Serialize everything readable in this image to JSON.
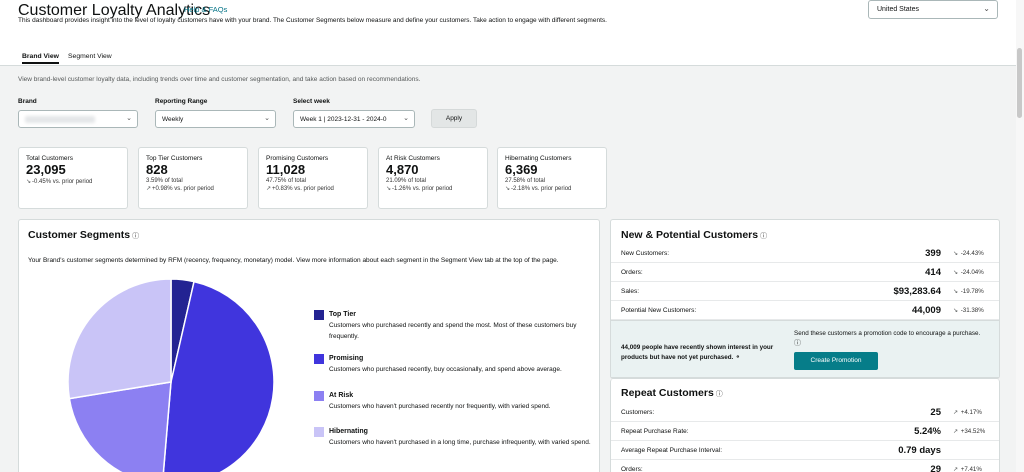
{
  "header": {
    "title": "Customer Loyalty Analytics",
    "help_link": "Help & FAQs",
    "description": "This dashboard provides insight into the level of loyalty customers have with your brand. The Customer Segments below measure and define your customers. Take action to engage with different segments.",
    "country": "United States"
  },
  "tabs": [
    {
      "label": "Brand View",
      "active": true
    },
    {
      "label": "Segment View",
      "active": false
    }
  ],
  "subdescription": "View brand-level customer loyalty data, including trends over time and customer segmentation, and take action based on recommendations.",
  "filters": {
    "brand_label": "Brand",
    "range_label": "Reporting Range",
    "range_value": "Weekly",
    "week_label": "Select week",
    "week_value": "Week 1 | 2023-12-31 - 2024-0",
    "apply": "Apply"
  },
  "cards": [
    {
      "label": "Total Customers",
      "value": "23,095",
      "sub": "",
      "trend": "-0.45% vs. prior period",
      "dir": "down"
    },
    {
      "label": "Top Tier Customers",
      "value": "828",
      "sub": "3.59% of total",
      "trend": "+0.98% vs. prior period",
      "dir": "up"
    },
    {
      "label": "Promising Customers",
      "value": "11,028",
      "sub": "47.75% of total",
      "trend": "+0.83% vs. prior period",
      "dir": "up"
    },
    {
      "label": "At Risk Customers",
      "value": "4,870",
      "sub": "21.09% of total",
      "trend": "-1.26% vs. prior period",
      "dir": "down"
    },
    {
      "label": "Hibernating Customers",
      "value": "6,369",
      "sub": "27.58% of total",
      "trend": "-2.18% vs. prior period",
      "dir": "down"
    }
  ],
  "segments": {
    "title": "Customer Segments",
    "description": "Your Brand's customer segments determined by RFM (recency, frequency, monetary) model. View more information about each segment in the Segment View tab at the top of the page.",
    "items": [
      {
        "name": "Top Tier",
        "text": "Customers who purchased recently and spend the most. Most of these customers buy frequently.",
        "color": "#232392",
        "percent": 3.59
      },
      {
        "name": "Promising",
        "text": "Customers who purchased recently, buy occasionally, and spend above average.",
        "color": "#4035dd",
        "percent": 47.75
      },
      {
        "name": "At Risk",
        "text": "Customers who haven't purchased recently nor frequently, with varied spend.",
        "color": "#8c80f2",
        "percent": 21.09
      },
      {
        "name": "Hibernating",
        "text": "Customers who haven't purchased in a long time, purchase infrequently, with varied spend.",
        "color": "#c9c4f7",
        "percent": 27.58
      }
    ]
  },
  "new_potential": {
    "title": "New & Potential Customers",
    "rows": [
      {
        "label": "New Customers:",
        "value": "399",
        "trend": "-24.43%"
      },
      {
        "label": "Orders:",
        "value": "414",
        "trend": "-24.04%"
      },
      {
        "label": "Sales:",
        "value": "$93,283.64",
        "trend": "-19.78%"
      },
      {
        "label": "Potential New Customers:",
        "value": "44,009",
        "trend": "-31.38%"
      }
    ],
    "promo_note": "44,009 people have recently shown interest in your products but have not yet purchased.",
    "promo_cta_text": "Send these customers a promotion code to encourage a purchase.",
    "promo_button": "Create Promotion"
  },
  "repeat": {
    "title": "Repeat Customers",
    "rows": [
      {
        "label": "Customers:",
        "value": "25",
        "trend": "+4.17%"
      },
      {
        "label": "Repeat Purchase Rate:",
        "value": "5.24%",
        "trend": "+34.52%"
      },
      {
        "label": "Average Repeat Purchase Interval:",
        "value": "0.79 days",
        "trend": ""
      },
      {
        "label": "Orders:",
        "value": "29",
        "trend": "+7.41%"
      }
    ]
  }
}
